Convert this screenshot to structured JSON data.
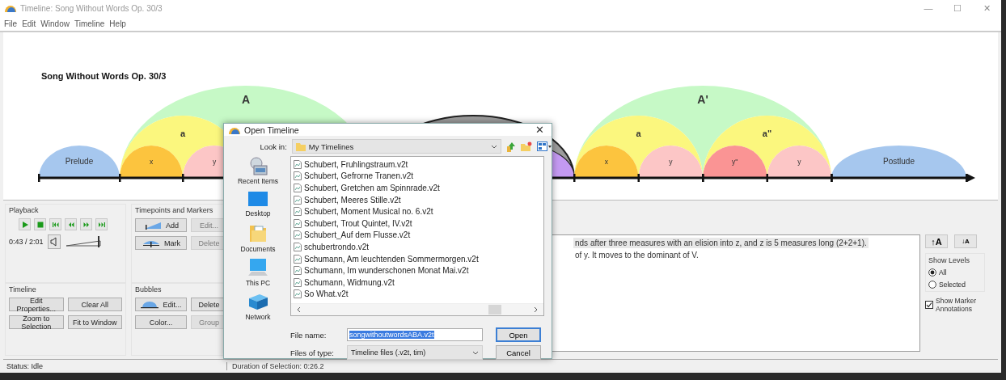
{
  "window": {
    "title": "Timeline: Song Without Words Op. 30/3",
    "controls": [
      "—",
      "☐",
      "✕"
    ]
  },
  "menu": [
    "File",
    "Edit",
    "Window",
    "Timeline",
    "Help"
  ],
  "timeline": {
    "title": "Song Without Words Op. 30/3",
    "bubbles": [
      {
        "label": "Prelude",
        "color": "#a6c7ee",
        "selected": false
      },
      {
        "label": "A",
        "color": "#c6f9c6",
        "selected": false,
        "children": [
          {
            "label": "a",
            "color": "#fbf77e",
            "selected": false,
            "children": [
              {
                "label": "x",
                "color": "#fcc43e",
                "selected": false
              },
              {
                "label": "y",
                "color": "#fcc6c6",
                "selected": false
              }
            ]
          }
        ]
      },
      {
        "color": "#9c9c9c",
        "selected": true,
        "children": [
          {
            "color": "#c49af2",
            "selected": false
          }
        ]
      },
      {
        "label": "A'",
        "color": "#c6f9c6",
        "selected": false,
        "children": [
          {
            "label": "a",
            "color": "#fbf77e",
            "selected": false,
            "children": [
              {
                "label": "x",
                "color": "#fcc43e",
                "selected": false
              },
              {
                "label": "y",
                "color": "#fcc6c6",
                "selected": false
              }
            ]
          },
          {
            "label": "a\"",
            "color": "#fbf77e",
            "selected": false,
            "children": [
              {
                "label": "y\"",
                "color": "#fa9494",
                "selected": false
              },
              {
                "label": "y",
                "color": "#fcc6c6",
                "selected": false
              }
            ]
          }
        ]
      },
      {
        "label": "Postlude",
        "color": "#a6c7ee",
        "selected": false
      }
    ]
  },
  "playback": {
    "title": "Playback",
    "time": "0:43 / 2:01",
    "volume": {
      "level": 0.95
    }
  },
  "timepoints": {
    "title": "Timepoints and Markers",
    "buttons": [
      {
        "label": "Add",
        "kind": "add",
        "disabled": false
      },
      {
        "label": "Edit...",
        "kind": "plain",
        "disabled": true
      },
      {
        "label": "Mark",
        "kind": "mark",
        "disabled": false
      },
      {
        "label": "Delete",
        "kind": "plain",
        "disabled": true
      }
    ]
  },
  "timeline_group": {
    "title": "Timeline",
    "buttons": [
      {
        "label": "Edit Properties...",
        "disabled": false
      },
      {
        "label": "Clear All",
        "disabled": false
      },
      {
        "label": "Zoom to Selection",
        "disabled": false
      },
      {
        "label": "Fit to Window",
        "disabled": false
      }
    ]
  },
  "bubbles_group": {
    "title": "Bubbles",
    "buttons": [
      {
        "label": "Edit...",
        "kind": "bubble",
        "disabled": false
      },
      {
        "label": "Delete",
        "kind": "plain",
        "disabled": false
      },
      {
        "label": "Color...",
        "kind": "plain",
        "disabled": false
      },
      {
        "label": "Group",
        "kind": "plain",
        "disabled": true
      }
    ]
  },
  "annotation": {
    "lines": [
      {
        "text": "nds after three measures with an elision into z, and z is 5 measures long (2+2+1).",
        "selected": true
      },
      {
        "text": "of y. It moves to the dominant of V.",
        "selected": false
      }
    ]
  },
  "font_buttons": [
    "↑A",
    "↓A"
  ],
  "show_levels": {
    "title": "Show Levels",
    "options": [
      {
        "label": "All",
        "selected": true
      },
      {
        "label": "Selected",
        "selected": false
      }
    ]
  },
  "show_marker_annotations": {
    "label": "Show Marker Annotations",
    "checked": true
  },
  "status_bar": {
    "status": "Status: Idle",
    "duration": "Duration of Selection: 0:26.2"
  },
  "dialog": {
    "title": "Open Timeline",
    "close": "✕",
    "look_in_label": "Look in:",
    "look_in": "My Timelines",
    "places": [
      {
        "label": "Recent Items",
        "kind": "recent"
      },
      {
        "label": "Desktop",
        "kind": "desktop"
      },
      {
        "label": "Documents",
        "kind": "documents"
      },
      {
        "label": "This PC",
        "kind": "pc"
      },
      {
        "label": "Network",
        "kind": "network"
      }
    ],
    "files": [
      "Schubert, Fruhlingstraum.v2t",
      "Schubert, Gefrorne Tranen.v2t",
      "Schubert, Gretchen am Spinnrade.v2t",
      "Schubert, Meeres Stille.v2t",
      "Schubert, Moment Musical no. 6.v2t",
      "Schubert, Trout Quintet, IV.v2t",
      "Schubert_Auf dem Flusse.v2t",
      "schubertrondo.v2t",
      "Schumann, Am leuchtenden Sommermorgen.v2t",
      "Schumann, Im wunderschonen Monat Mai.v2t",
      "Schumann, Widmung.v2t",
      "So What.v2t"
    ],
    "file_name_label": "File name:",
    "file_name": "songwithoutwordsABA.v2t",
    "file_type_label": "Files of type:",
    "file_type": "Timeline files (.v2t, tim)",
    "buttons": [
      "Open",
      "Cancel"
    ]
  }
}
